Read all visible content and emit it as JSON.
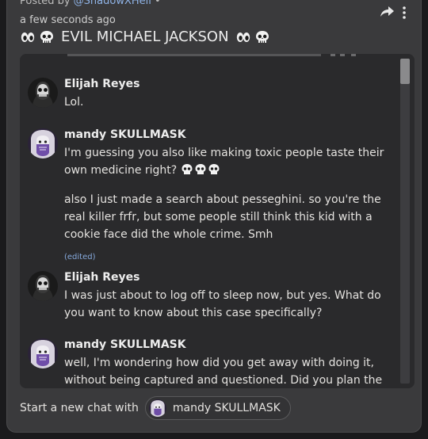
{
  "header": {
    "posted_prefix": "Posted by",
    "author": "@ShadowXHell",
    "separator": "•",
    "timestamp": "a few seconds ago",
    "title": "EVIL MICHAEL JACKSON",
    "share_icon": "share-arrow-icon",
    "more_icon": "vertical-dots-icon"
  },
  "messages": [
    {
      "name": "Elijah Reyes",
      "text": "Lol."
    },
    {
      "name": "mandy SKULLMASK",
      "text": "I'm guessing you also like making toxic people taste their own medicine right?",
      "text_extra": "also I just made a search about pesseghini. so you're the real killer frfr, but some people still think this kid with a cookie face did the whole crime. Smh",
      "edited": "(edited)"
    },
    {
      "name": "Elijah Reyes",
      "text": "I was just about to log off to sleep now, but yes. What do you want to know about this case specifically?"
    },
    {
      "name": "mandy SKULLMASK",
      "text": "well, I'm wondering how did you get away with doing it, without being captured and questioned. Did you plan the"
    }
  ],
  "footer": {
    "label": "Start a new chat with",
    "chip_name": "mandy SKULLMASK"
  },
  "colors": {
    "panel": "#3a3a3c",
    "chat_bg": "#2a2a2c",
    "link": "#8fb3e6"
  }
}
